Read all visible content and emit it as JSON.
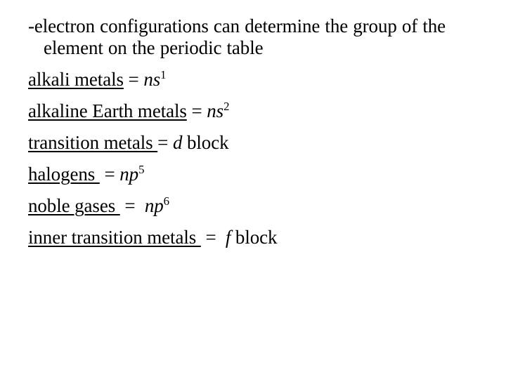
{
  "slide": {
    "background_color": "#ffffff",
    "text_color": "#000000",
    "intro": {
      "line1": "-electron configurations can determine the group",
      "line2": "of the element on the periodic table",
      "full_text": "-electron configurations can determine the group of the element on the periodic table"
    },
    "definitions": [
      {
        "term": "alkali metals",
        "term_underlined": true,
        "equals": " = ",
        "config_base": "ns",
        "config_superscript": "1",
        "config_suffix": "",
        "full_text": "alkali metals = ns1"
      },
      {
        "term": "alkaline Earth metals",
        "term_underlined": true,
        "equals": " = ",
        "config_base": "ns",
        "config_superscript": "2",
        "config_suffix": "",
        "full_text": "alkaline Earth metals = ns2"
      },
      {
        "term": "transition metals ",
        "term_underlined": true,
        "equals": "= ",
        "config_base": "d",
        "config_superscript": "",
        "config_suffix": " block",
        "full_text": "transition metals = d block"
      },
      {
        "term": "halogens ",
        "term_underlined": true,
        "equals": " = ",
        "config_base": "np",
        "config_superscript": "5",
        "config_suffix": "",
        "full_text": "halogens = np5"
      },
      {
        "term": "noble gases ",
        "term_underlined": true,
        "equals": " =  ",
        "config_base": "np",
        "config_superscript": "6",
        "config_suffix": "",
        "full_text": "noble gases = np6"
      },
      {
        "term": "inner transition metals ",
        "term_underlined": true,
        "equals": " =  ",
        "config_base": "f",
        "config_superscript": "",
        "config_suffix": " block",
        "full_text": "inner transition metals = f block"
      }
    ]
  }
}
